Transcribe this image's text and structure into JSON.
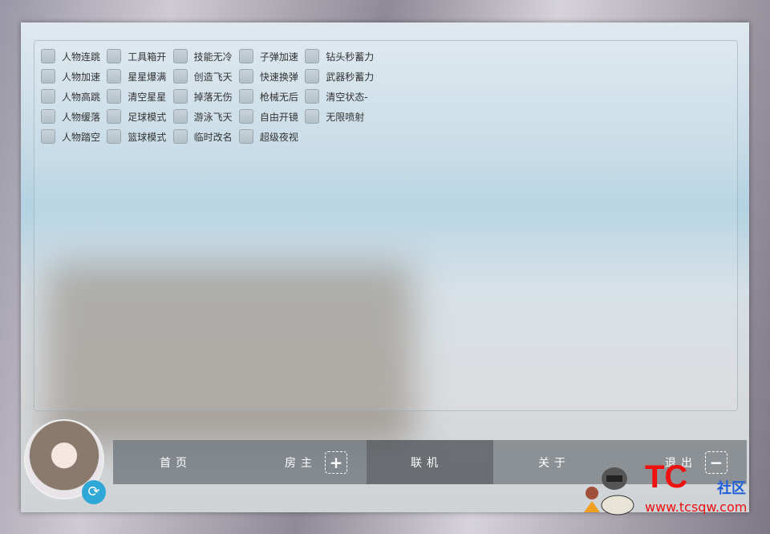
{
  "checkboxes": [
    [
      "人物连跳",
      "工具箱开",
      "技能无冷",
      "子弹加速",
      "钻头秒蓄力"
    ],
    [
      "人物加速",
      "星星爆满",
      "创造飞天",
      "快速换弹",
      "武器秒蓄力"
    ],
    [
      "人物高跳",
      "清空星星",
      "掉落无伤",
      "枪械无后",
      "清空状态-"
    ],
    [
      "人物缓落",
      "足球模式",
      "游泳飞天",
      "自由开镜",
      "无限喷射"
    ],
    [
      "人物踏空",
      "篮球模式",
      "临时改名",
      "超级夜视"
    ]
  ],
  "nav": {
    "home": "首页",
    "host": "房主",
    "host_icon": "+",
    "online": "联机",
    "about": "关于",
    "exit": "退出",
    "exit_icon": "−"
  },
  "icons": {
    "refresh": "⟳"
  },
  "watermark": {
    "logo": "TC",
    "community": "社区",
    "url": "www.tcsqw.com"
  },
  "colors": {
    "accent": "#2fa8d8",
    "watermark_red": "#f01010",
    "watermark_blue": "#1f5fd8"
  }
}
